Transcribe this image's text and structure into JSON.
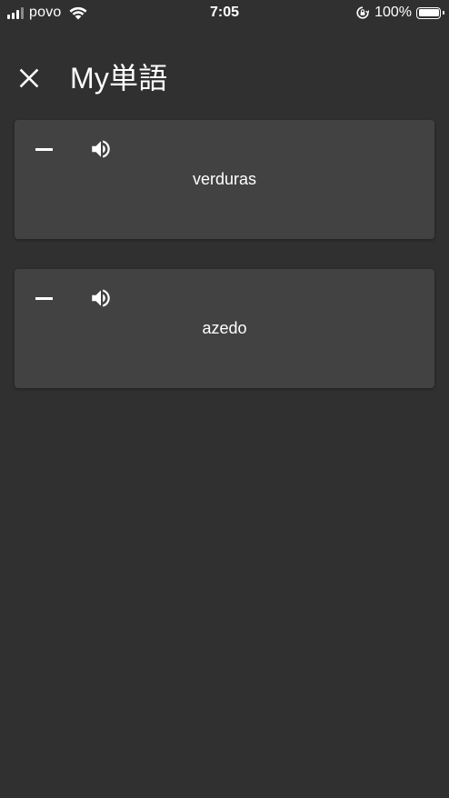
{
  "status_bar": {
    "carrier": "povo",
    "time": "7:05",
    "battery_percent": "100%",
    "battery_level": 1.0,
    "signal_bars_active": 3,
    "signal_bars_total": 4
  },
  "header": {
    "title": "My単語",
    "close_icon": "close-icon"
  },
  "words": [
    {
      "text": "verduras",
      "remove_icon": "minus-icon",
      "audio_icon": "speaker-icon"
    },
    {
      "text": "azedo",
      "remove_icon": "minus-icon",
      "audio_icon": "speaker-icon"
    }
  ],
  "colors": {
    "background": "#303030",
    "card": "#424242",
    "text": "#ffffff"
  }
}
